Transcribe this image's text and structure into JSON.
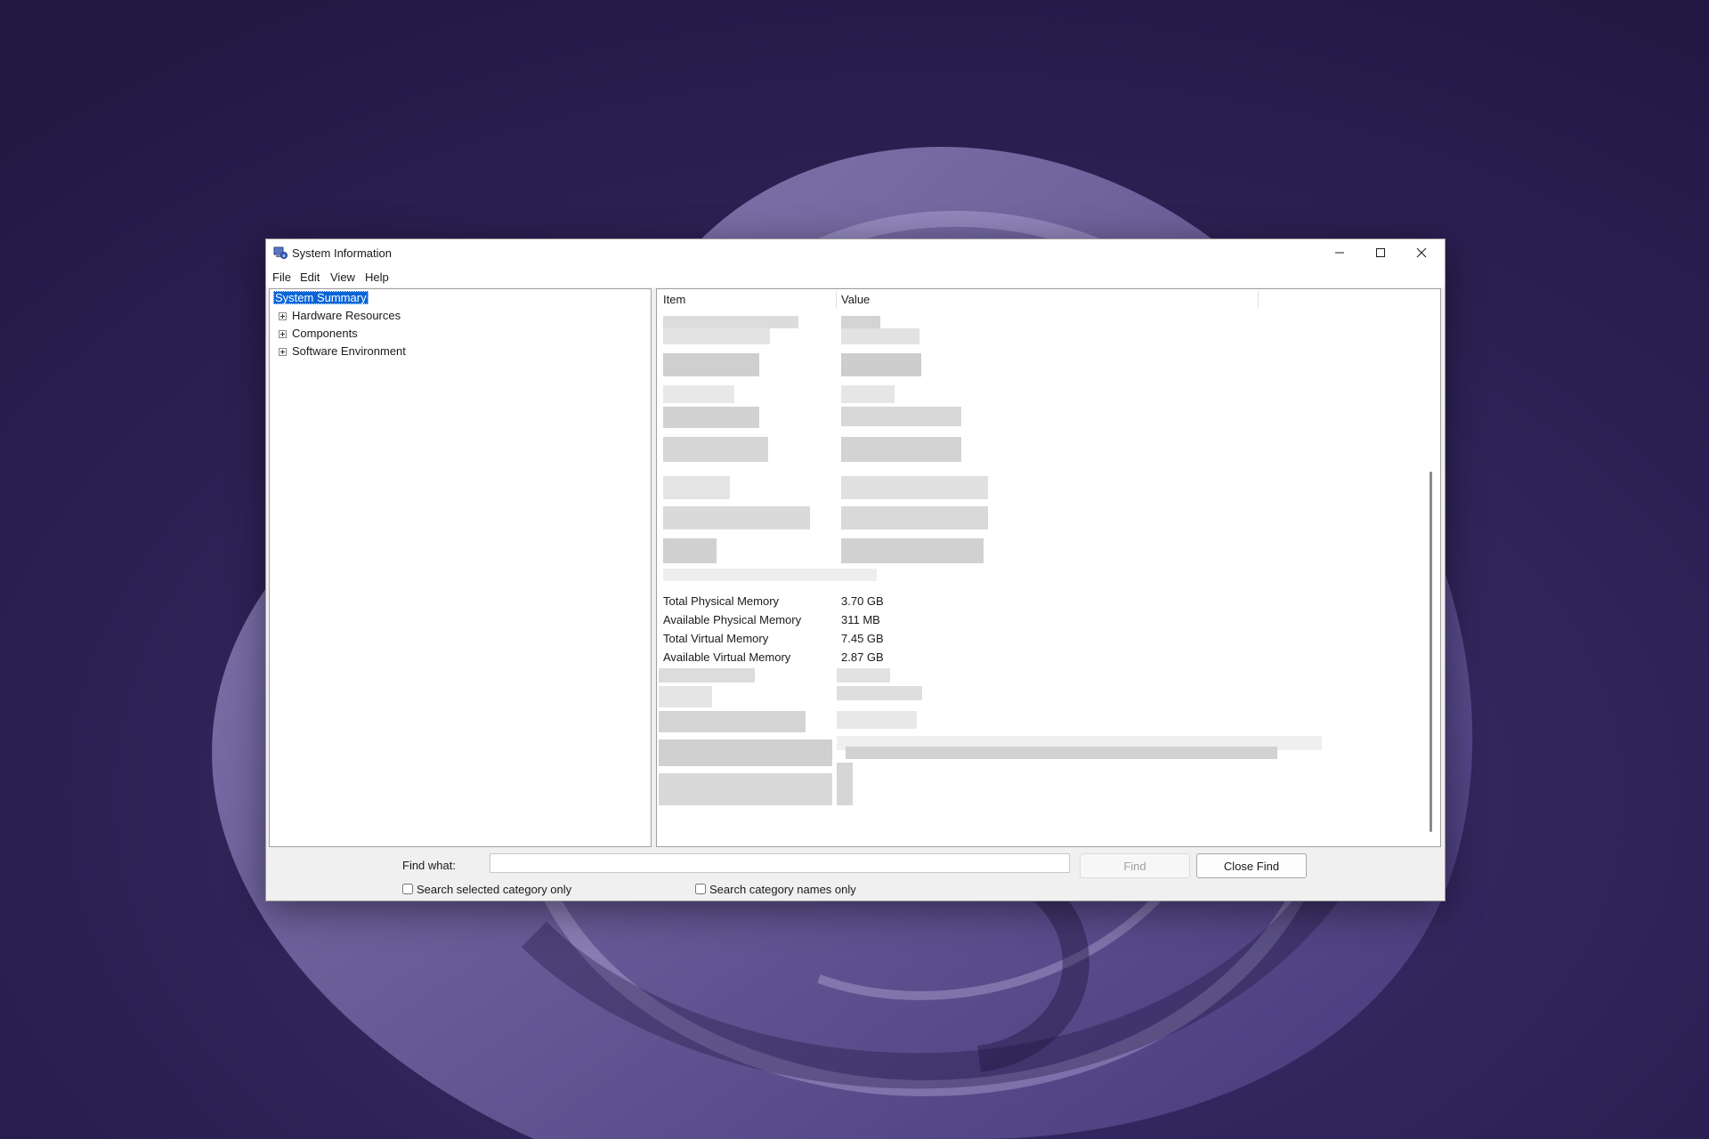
{
  "window": {
    "title": "System Information"
  },
  "menu": {
    "items": [
      "File",
      "Edit",
      "View",
      "Help"
    ]
  },
  "tree": {
    "selected": "System Summary",
    "children": [
      "Hardware Resources",
      "Components",
      "Software Environment"
    ]
  },
  "list": {
    "headers": {
      "item": "Item",
      "value": "Value"
    },
    "rows": [
      {
        "item": "Total Physical Memory",
        "value": "3.70 GB"
      },
      {
        "item": "Available Physical Memory",
        "value": "311 MB"
      },
      {
        "item": "Total Virtual Memory",
        "value": "7.45 GB"
      },
      {
        "item": "Available Virtual Memory",
        "value": "2.87 GB"
      }
    ]
  },
  "find": {
    "label": "Find what:",
    "value": "",
    "find_button": "Find",
    "close_button": "Close Find",
    "option_selected_category": "Search selected category only",
    "option_category_names": "Search category names only"
  },
  "icons": {
    "app": "system-info-icon",
    "minimize": "minimize-icon",
    "maximize": "maximize-icon",
    "close": "close-icon",
    "expander": "plus-box-icon"
  },
  "colors": {
    "selection": "#0a64d8",
    "wallpaper": "#2a1e52"
  }
}
